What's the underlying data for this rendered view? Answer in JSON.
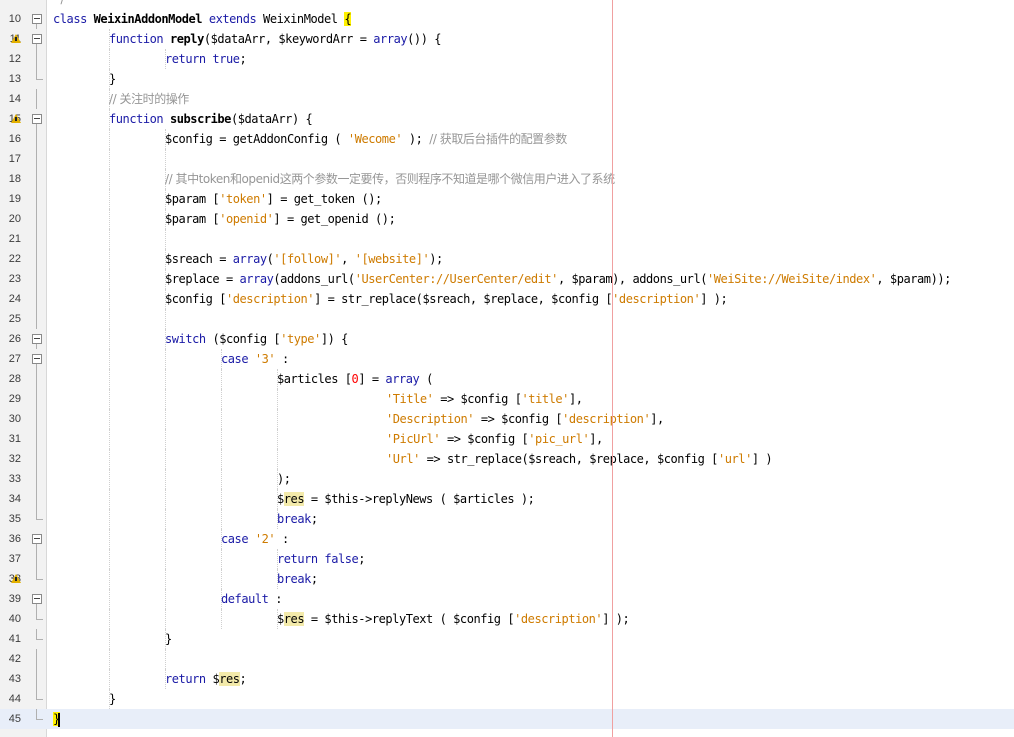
{
  "editor": {
    "first_line_partial": "*/",
    "lines": [
      {
        "n": "10",
        "fold": "box",
        "indent": 0,
        "segments": [
          [
            "kw",
            "class "
          ],
          [
            "fn",
            "WeixinAddonModel"
          ],
          [
            "kw",
            " extends "
          ],
          [
            "var",
            "WeixinModel "
          ],
          [
            "brace",
            "{"
          ]
        ]
      },
      {
        "n": "11",
        "warn": true,
        "fold": "box",
        "indent": 1,
        "segments": [
          [
            "kw",
            "function "
          ],
          [
            "fn",
            "reply"
          ],
          [
            "var",
            "("
          ],
          [
            "var",
            "$dataArr"
          ],
          [
            "var",
            ", "
          ],
          [
            "var",
            "$keywordArr"
          ],
          [
            "var",
            " = "
          ],
          [
            "kw",
            "array"
          ],
          [
            "var",
            "()) {"
          ]
        ]
      },
      {
        "n": "12",
        "fold": "line",
        "indent": 2,
        "segments": [
          [
            "kw",
            "return true"
          ],
          [
            "var",
            ";"
          ]
        ]
      },
      {
        "n": "13",
        "fold": "end",
        "indent": 1,
        "segments": [
          [
            "var",
            "}"
          ]
        ]
      },
      {
        "n": "14",
        "fold": "line",
        "indent": 1,
        "segments": [
          [
            "com",
            "// 关注时的操作"
          ]
        ]
      },
      {
        "n": "15",
        "warn": true,
        "fold": "box",
        "indent": 1,
        "segments": [
          [
            "kw",
            "function "
          ],
          [
            "fn",
            "subscribe"
          ],
          [
            "var",
            "("
          ],
          [
            "var",
            "$dataArr"
          ],
          [
            "var",
            ") {"
          ]
        ]
      },
      {
        "n": "16",
        "fold": "line",
        "indent": 2,
        "segments": [
          [
            "var",
            "$config = getAddonConfig ( "
          ],
          [
            "str",
            "'Wecome'"
          ],
          [
            "var",
            " ); "
          ],
          [
            "com",
            "// 获取后台插件的配置参数"
          ]
        ]
      },
      {
        "n": "17",
        "fold": "line",
        "indent": 2,
        "segments": []
      },
      {
        "n": "18",
        "fold": "line",
        "indent": 2,
        "segments": [
          [
            "com",
            "// 其中token和openid这两个参数一定要传，否则程序不知道是哪个微信用户进入了系统"
          ]
        ]
      },
      {
        "n": "19",
        "fold": "line",
        "indent": 2,
        "segments": [
          [
            "var",
            "$param ["
          ],
          [
            "str",
            "'token'"
          ],
          [
            "var",
            "] = get_token ();"
          ]
        ]
      },
      {
        "n": "20",
        "fold": "line",
        "indent": 2,
        "segments": [
          [
            "var",
            "$param ["
          ],
          [
            "str",
            "'openid'"
          ],
          [
            "var",
            "] = get_openid ();"
          ]
        ]
      },
      {
        "n": "21",
        "fold": "line",
        "indent": 2,
        "segments": []
      },
      {
        "n": "22",
        "fold": "line",
        "indent": 2,
        "segments": [
          [
            "var",
            "$sreach = "
          ],
          [
            "kw",
            "array"
          ],
          [
            "var",
            "("
          ],
          [
            "str",
            "'[follow]'"
          ],
          [
            "var",
            ", "
          ],
          [
            "str",
            "'[website]'"
          ],
          [
            "var",
            ");"
          ]
        ]
      },
      {
        "n": "23",
        "fold": "line",
        "indent": 2,
        "segments": [
          [
            "var",
            "$replace = "
          ],
          [
            "kw",
            "array"
          ],
          [
            "var",
            "(addons_url("
          ],
          [
            "str",
            "'UserCenter://UserCenter/edit'"
          ],
          [
            "var",
            ", $param), addons_url("
          ],
          [
            "str",
            "'WeiSite://WeiSite/index'"
          ],
          [
            "var",
            ", $param));"
          ]
        ]
      },
      {
        "n": "24",
        "fold": "line",
        "indent": 2,
        "segments": [
          [
            "var",
            "$config ["
          ],
          [
            "str",
            "'description'"
          ],
          [
            "var",
            "] = str_replace($sreach, $replace, $config ["
          ],
          [
            "str",
            "'description'"
          ],
          [
            "var",
            "] );"
          ]
        ]
      },
      {
        "n": "25",
        "fold": "line",
        "indent": 2,
        "segments": []
      },
      {
        "n": "26",
        "fold": "box",
        "indent": 2,
        "segments": [
          [
            "kw",
            "switch "
          ],
          [
            "var",
            "($config ["
          ],
          [
            "str",
            "'type'"
          ],
          [
            "var",
            "]) {"
          ]
        ]
      },
      {
        "n": "27",
        "fold": "box",
        "indent": 3,
        "segments": [
          [
            "kw",
            "case "
          ],
          [
            "str",
            "'3'"
          ],
          [
            "var",
            " :"
          ]
        ]
      },
      {
        "n": "28",
        "fold": "line",
        "indent": 4,
        "segments": [
          [
            "var",
            "$articles ["
          ],
          [
            "num",
            "0"
          ],
          [
            "var",
            "] = "
          ],
          [
            "kw",
            "array"
          ],
          [
            "var",
            " ("
          ]
        ]
      },
      {
        "n": "29",
        "fold": "line",
        "indent": 6,
        "extra": true,
        "segments": [
          [
            "str",
            "'Title'"
          ],
          [
            "var",
            " => $config ["
          ],
          [
            "str",
            "'title'"
          ],
          [
            "var",
            "],"
          ]
        ]
      },
      {
        "n": "30",
        "fold": "line",
        "indent": 6,
        "extra": true,
        "segments": [
          [
            "str",
            "'Description'"
          ],
          [
            "var",
            " => $config ["
          ],
          [
            "str",
            "'description'"
          ],
          [
            "var",
            "],"
          ]
        ]
      },
      {
        "n": "31",
        "fold": "line",
        "indent": 6,
        "extra": true,
        "segments": [
          [
            "str",
            "'PicUrl'"
          ],
          [
            "var",
            " => $config ["
          ],
          [
            "str",
            "'pic_url'"
          ],
          [
            "var",
            "],"
          ]
        ]
      },
      {
        "n": "32",
        "fold": "line",
        "indent": 6,
        "extra": true,
        "segments": [
          [
            "str",
            "'Url'"
          ],
          [
            "var",
            " => str_replace($sreach, $replace, $config ["
          ],
          [
            "str",
            "'url'"
          ],
          [
            "var",
            "] )"
          ]
        ]
      },
      {
        "n": "33",
        "fold": "line",
        "indent": 4,
        "segments": [
          [
            "var",
            ");"
          ]
        ]
      },
      {
        "n": "34",
        "fold": "line",
        "indent": 4,
        "segments": [
          [
            "var",
            "$"
          ],
          [
            "hl",
            "res"
          ],
          [
            "var",
            " = $this->replyNews ( $articles );"
          ]
        ]
      },
      {
        "n": "35",
        "fold": "end",
        "indent": 4,
        "segments": [
          [
            "kw",
            "break"
          ],
          [
            "var",
            ";"
          ]
        ]
      },
      {
        "n": "36",
        "fold": "box",
        "indent": 3,
        "segments": [
          [
            "kw",
            "case "
          ],
          [
            "str",
            "'2'"
          ],
          [
            "var",
            " :"
          ]
        ]
      },
      {
        "n": "37",
        "fold": "line",
        "indent": 4,
        "segments": [
          [
            "kw",
            "return false"
          ],
          [
            "var",
            ";"
          ]
        ]
      },
      {
        "n": "38",
        "warn": true,
        "fold": "end",
        "indent": 4,
        "segments": [
          [
            "kw",
            "break"
          ],
          [
            "var",
            ";"
          ]
        ]
      },
      {
        "n": "39",
        "fold": "box",
        "indent": 3,
        "segments": [
          [
            "kw",
            "default"
          ],
          [
            "var",
            " :"
          ]
        ]
      },
      {
        "n": "40",
        "fold": "end",
        "indent": 4,
        "segments": [
          [
            "var",
            "$"
          ],
          [
            "hl",
            "res"
          ],
          [
            "var",
            " = $this->replyText ( $config ["
          ],
          [
            "str",
            "'description'"
          ],
          [
            "var",
            "] );"
          ]
        ]
      },
      {
        "n": "41",
        "fold": "end",
        "indent": 2,
        "segments": [
          [
            "var",
            "}"
          ]
        ]
      },
      {
        "n": "42",
        "fold": "line",
        "indent": 2,
        "segments": []
      },
      {
        "n": "43",
        "fold": "line",
        "indent": 2,
        "segments": [
          [
            "kw",
            "return "
          ],
          [
            "var",
            "$"
          ],
          [
            "hl",
            "res"
          ],
          [
            "var",
            ";"
          ]
        ]
      },
      {
        "n": "44",
        "fold": "end",
        "indent": 1,
        "segments": [
          [
            "var",
            "}"
          ]
        ]
      },
      {
        "n": "45",
        "fold": "end",
        "indent": 0,
        "current": true,
        "segments": [
          [
            "brace2",
            "}"
          ]
        ]
      }
    ]
  }
}
